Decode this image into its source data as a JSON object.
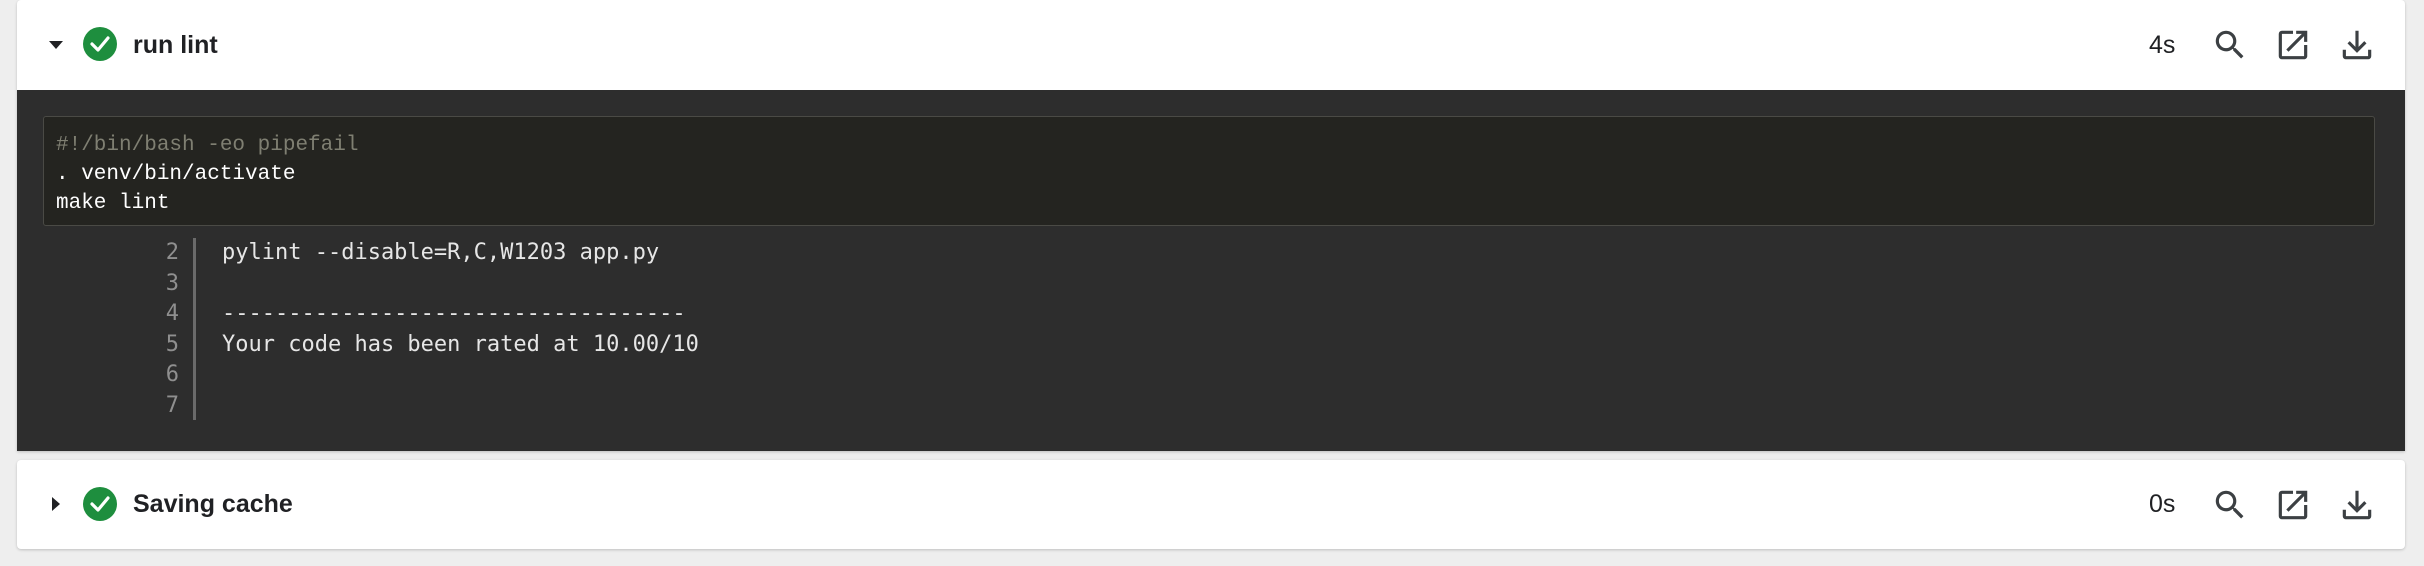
{
  "steps": [
    {
      "title": "run lint",
      "duration": "4s",
      "expanded": true,
      "status": "success",
      "script": [
        "#!/bin/bash -eo pipefail",
        ". venv/bin/activate",
        "make lint"
      ],
      "output": [
        {
          "n": "2",
          "text": "pylint --disable=R,C,W1203 app.py"
        },
        {
          "n": "3",
          "text": ""
        },
        {
          "n": "4",
          "text": "-----------------------------------"
        },
        {
          "n": "5",
          "text": "Your code has been rated at 10.00/10"
        },
        {
          "n": "6",
          "text": ""
        },
        {
          "n": "7",
          "text": ""
        }
      ]
    },
    {
      "title": "Saving cache",
      "duration": "0s",
      "expanded": false,
      "status": "success"
    }
  ],
  "icons": {
    "expand": "chevron-down-icon",
    "collapse": "chevron-right-icon",
    "status": "check-circle-icon",
    "search": "search-icon",
    "open": "open-in-new-icon",
    "download": "download-icon"
  },
  "colors": {
    "success": "#1e8e3e",
    "log_background": "#2d2d2d",
    "script_background": "#242420",
    "comment": "#7f7f72"
  }
}
